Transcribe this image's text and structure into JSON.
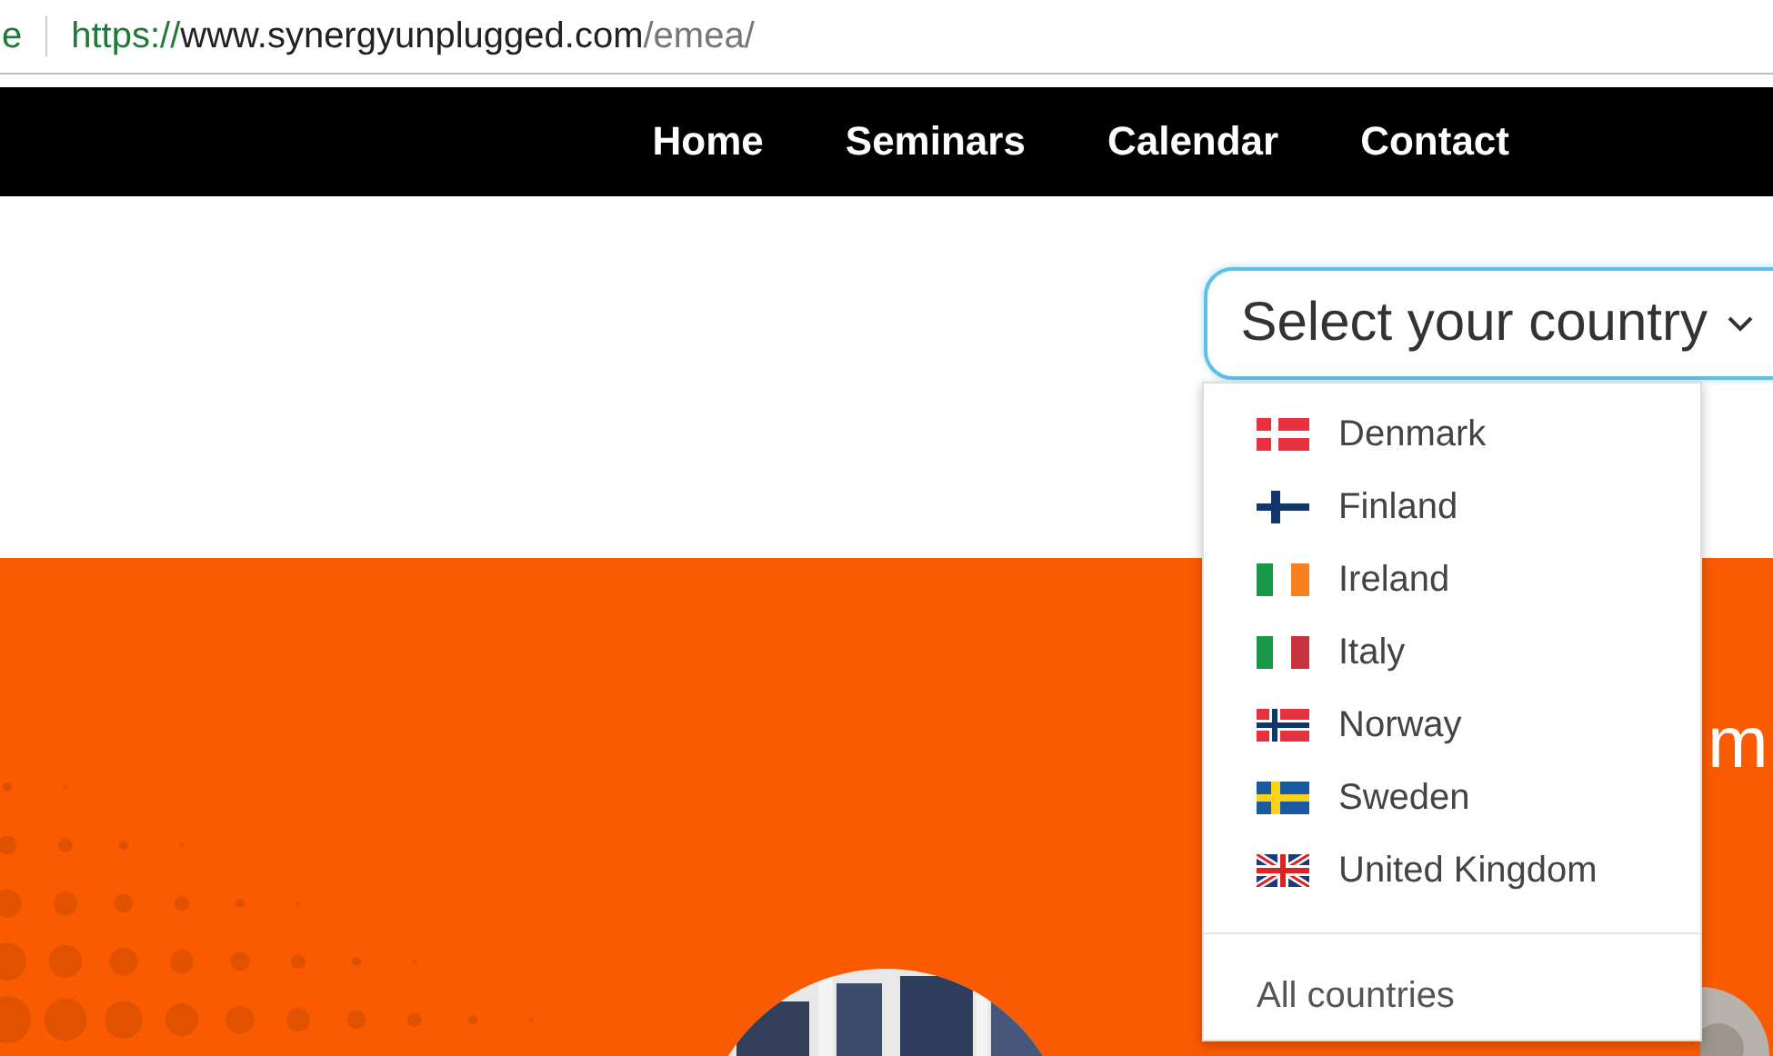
{
  "address_bar": {
    "status_fragment": "e",
    "url_scheme": "https://",
    "url_host": "www.synergyunplugged.com",
    "url_path": "/emea/"
  },
  "nav": {
    "items": [
      {
        "label": "Home"
      },
      {
        "label": "Seminars"
      },
      {
        "label": "Calendar"
      },
      {
        "label": "Contact"
      }
    ]
  },
  "country_select": {
    "label": "Select your country",
    "expanded": true,
    "options": [
      {
        "label": "Denmark"
      },
      {
        "label": "Finland"
      },
      {
        "label": "Ireland"
      },
      {
        "label": "Italy"
      },
      {
        "label": "Norway"
      },
      {
        "label": "Sweden"
      },
      {
        "label": "United Kingdom"
      }
    ],
    "footer_option": "All countries"
  },
  "hero": {
    "heading_fragment": "m"
  }
}
